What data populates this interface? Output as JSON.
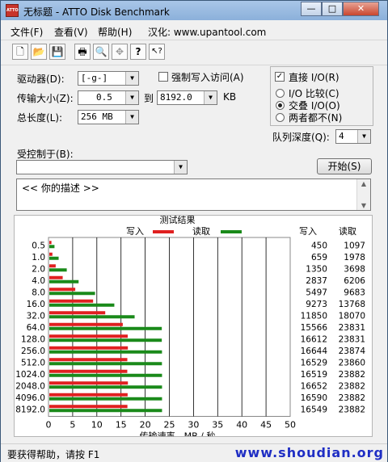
{
  "window": {
    "title": "无标题 - ATTO Disk Benchmark",
    "app_icon": "ATTO"
  },
  "window_buttons": {
    "minimize": "—",
    "maximize": "□",
    "close": "✕"
  },
  "menu": [
    "文件(F)",
    "查看(V)",
    "帮助(H)",
    "汉化: www.upantool.com"
  ],
  "toolbar_icons": [
    "new-file-icon",
    "open-folder-icon",
    "save-icon",
    "print-icon",
    "print-preview-icon",
    "move-icon",
    "help-icon",
    "context-help-icon"
  ],
  "toolbar_glyphs": [
    "🗋",
    "📂",
    "💾",
    "🖶",
    "🔍",
    "✥",
    "?",
    "↖?"
  ],
  "settings": {
    "drive_label": "驱动器(D):",
    "drive_value": "[-g-]",
    "transfer_size_label": "传输大小(Z):",
    "transfer_from": "0.5",
    "transfer_to_word": "到",
    "transfer_to": "8192.0",
    "transfer_unit": "KB",
    "total_length_label": "总长度(L):",
    "total_length_value": "256 MB",
    "force_write_label": "强制写入访问(A)",
    "force_write_checked": false,
    "direct_io_label": "直接 I/O(R)",
    "direct_io_checked": true,
    "io_compare_label": "I/O 比较(C)",
    "overlapped_io_label": "交叠 I/O(O)",
    "neither_label": "两者都不(N)",
    "selected_mode": "overlapped",
    "queue_depth_label": "队列深度(Q):",
    "queue_depth_value": "4",
    "controlled_by_label": "受控制于(B):",
    "controlled_by_value": "",
    "start_button": "开始(S)",
    "description": "<<   你的描述    >>"
  },
  "chart_data": {
    "type": "bar",
    "title": "测试结果",
    "xlabel": "传输速率 - MB / 秒",
    "xlim": [
      0,
      50
    ],
    "x_ticks": [
      "0",
      "5",
      "10",
      "15",
      "20",
      "25",
      "30",
      "35",
      "40",
      "45",
      "50"
    ],
    "categories": [
      "0.5",
      "1.0",
      "2.0",
      "4.0",
      "8.0",
      "16.0",
      "32.0",
      "64.0",
      "128.0",
      "256.0",
      "512.0",
      "1024.0",
      "2048.0",
      "4096.0",
      "8192.0"
    ],
    "series": [
      {
        "name": "写入",
        "color": "#e02020",
        "values": [
          0.44,
          0.64,
          1.32,
          2.77,
          5.37,
          9.06,
          11.57,
          15.2,
          16.22,
          16.25,
          16.14,
          16.13,
          16.26,
          16.2,
          16.16
        ]
      },
      {
        "name": "读取",
        "color": "#1a8a1a",
        "values": [
          1.07,
          1.93,
          3.61,
          6.06,
          9.46,
          13.45,
          17.65,
          23.27,
          23.27,
          23.31,
          23.3,
          23.32,
          23.32,
          23.32,
          23.32
        ]
      }
    ],
    "table_headers": [
      "写入",
      "读取"
    ],
    "table_write": [
      "450",
      "659",
      "1350",
      "2837",
      "5497",
      "9273",
      "11850",
      "15566",
      "16612",
      "16644",
      "16529",
      "16519",
      "16652",
      "16590",
      "16549"
    ],
    "table_read": [
      "1097",
      "1978",
      "3698",
      "6206",
      "9683",
      "13768",
      "18070",
      "23831",
      "23831",
      "23874",
      "23860",
      "23882",
      "23882",
      "23882",
      "23882"
    ],
    "grid": true,
    "legend_position": "top"
  },
  "status": {
    "text": "要获得帮助，请按 F1",
    "watermark": "www.shoudian.org"
  }
}
